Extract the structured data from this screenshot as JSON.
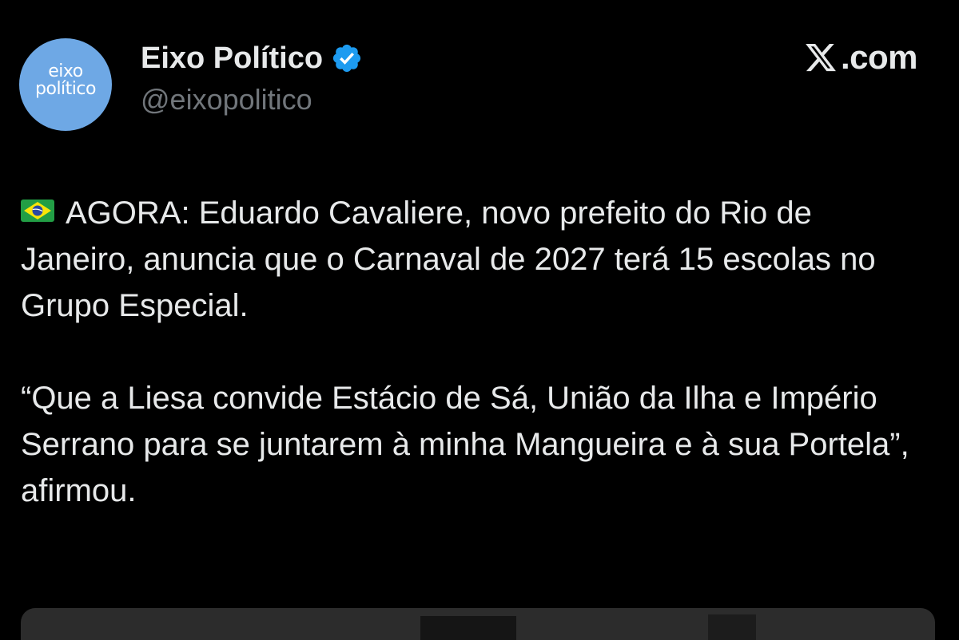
{
  "author": {
    "avatar_line1": "eixo",
    "avatar_line2": "político",
    "display_name": "Eixo Político",
    "handle": "@eixopolitico",
    "verified": true,
    "verified_color": "#1d9bf0",
    "avatar_color": "#6ea8e5"
  },
  "brand": {
    "text": ".com",
    "icon": "x-logo-icon"
  },
  "post": {
    "flag_icon": "brazil-flag-icon",
    "paragraph1": "AGORA: Eduardo Cavaliere, novo prefeito do Rio de Janeiro, anuncia que o Carnaval de 2027 terá 15 escolas no Grupo Especial.",
    "paragraph2": "“Que a Liesa convide Estácio de Sá, União da Ilha e Império Serrano para se juntarem à minha Mangueira e à sua Portela”, afirmou."
  },
  "colors": {
    "background": "#000000",
    "text_primary": "#e7e9ea",
    "text_secondary": "#71767b"
  }
}
